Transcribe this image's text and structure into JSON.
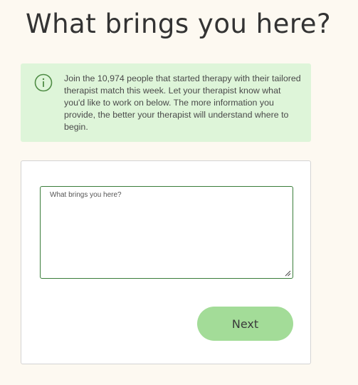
{
  "header": {
    "title": "What brings you here?"
  },
  "info_banner": {
    "icon": "info-icon",
    "text": "Join the 10,974 people that started therapy with their tailored therapist match this week. Let your therapist know what you'd like to work on below. The more information you provide, the better your therapist will understand where to begin."
  },
  "form": {
    "textarea_placeholder": "What brings you here?",
    "textarea_value": "",
    "next_label": "Next"
  },
  "colors": {
    "background": "#fdf9f1",
    "banner_bg": "#def5d9",
    "accent_green": "#3a7d3a",
    "button_bg": "#a3dc98"
  }
}
